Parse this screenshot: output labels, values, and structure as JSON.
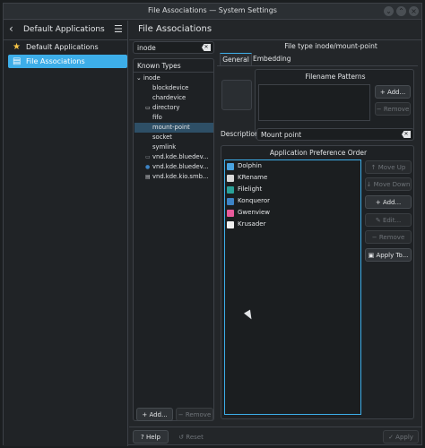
{
  "window": {
    "title": "File Associations — System Settings"
  },
  "sidebar": {
    "title": "Default Applications",
    "items": [
      {
        "label": "Default Applications",
        "icon": "star-icon",
        "selected": false
      },
      {
        "label": "File Associations",
        "icon": "file-assoc-icon",
        "selected": true
      }
    ]
  },
  "main": {
    "title": "File Associations",
    "search": {
      "value": "inode"
    },
    "known_types_label": "Known Types",
    "tree": [
      {
        "label": "inode",
        "level": 0,
        "expanded": true
      },
      {
        "label": "blockdevice",
        "level": 1,
        "icon": ""
      },
      {
        "label": "chardevice",
        "level": 1,
        "icon": ""
      },
      {
        "label": "directory",
        "level": 1,
        "icon": "folder-icon"
      },
      {
        "label": "fifo",
        "level": 1,
        "icon": ""
      },
      {
        "label": "mount-point",
        "level": 1,
        "icon": "",
        "selected": true
      },
      {
        "label": "socket",
        "level": 1,
        "icon": ""
      },
      {
        "label": "symlink",
        "level": 1,
        "icon": ""
      },
      {
        "label": "vnd.kde.bluedev...",
        "level": 1,
        "icon": "monitor-icon"
      },
      {
        "label": "vnd.kde.bluedev...",
        "level": 1,
        "icon": "bluetooth-icon"
      },
      {
        "label": "vnd.kde.kio.smb...",
        "level": 1,
        "icon": "printer-icon"
      }
    ],
    "add_label": "Add...",
    "remove_label": "Remove",
    "file_type_label": "File type inode/mount-point",
    "tabs": [
      "General",
      "Embedding"
    ],
    "filename_patterns_label": "Filename Patterns",
    "patterns_add": "Add...",
    "patterns_remove": "Remove",
    "description_label": "Description:",
    "description_value": "Mount point",
    "app_pref_label": "Application Preference Order",
    "apps": [
      {
        "name": "Dolphin",
        "color": "#4aa3df"
      },
      {
        "name": "KRename",
        "color": "#d9d9d9"
      },
      {
        "name": "Filelight",
        "color": "#2aa198"
      },
      {
        "name": "Konqueror",
        "color": "#3d84c6"
      },
      {
        "name": "Gwenview",
        "color": "#e85a9b"
      },
      {
        "name": "Krusader",
        "color": "#f0f0f0"
      }
    ],
    "app_buttons": {
      "move_up": "Move Up",
      "move_down": "Move Down",
      "add": "Add...",
      "edit": "Edit...",
      "remove": "Remove",
      "apply_to": "Apply To..."
    },
    "footer": {
      "help": "Help",
      "reset": "Reset",
      "apply": "Apply"
    }
  }
}
